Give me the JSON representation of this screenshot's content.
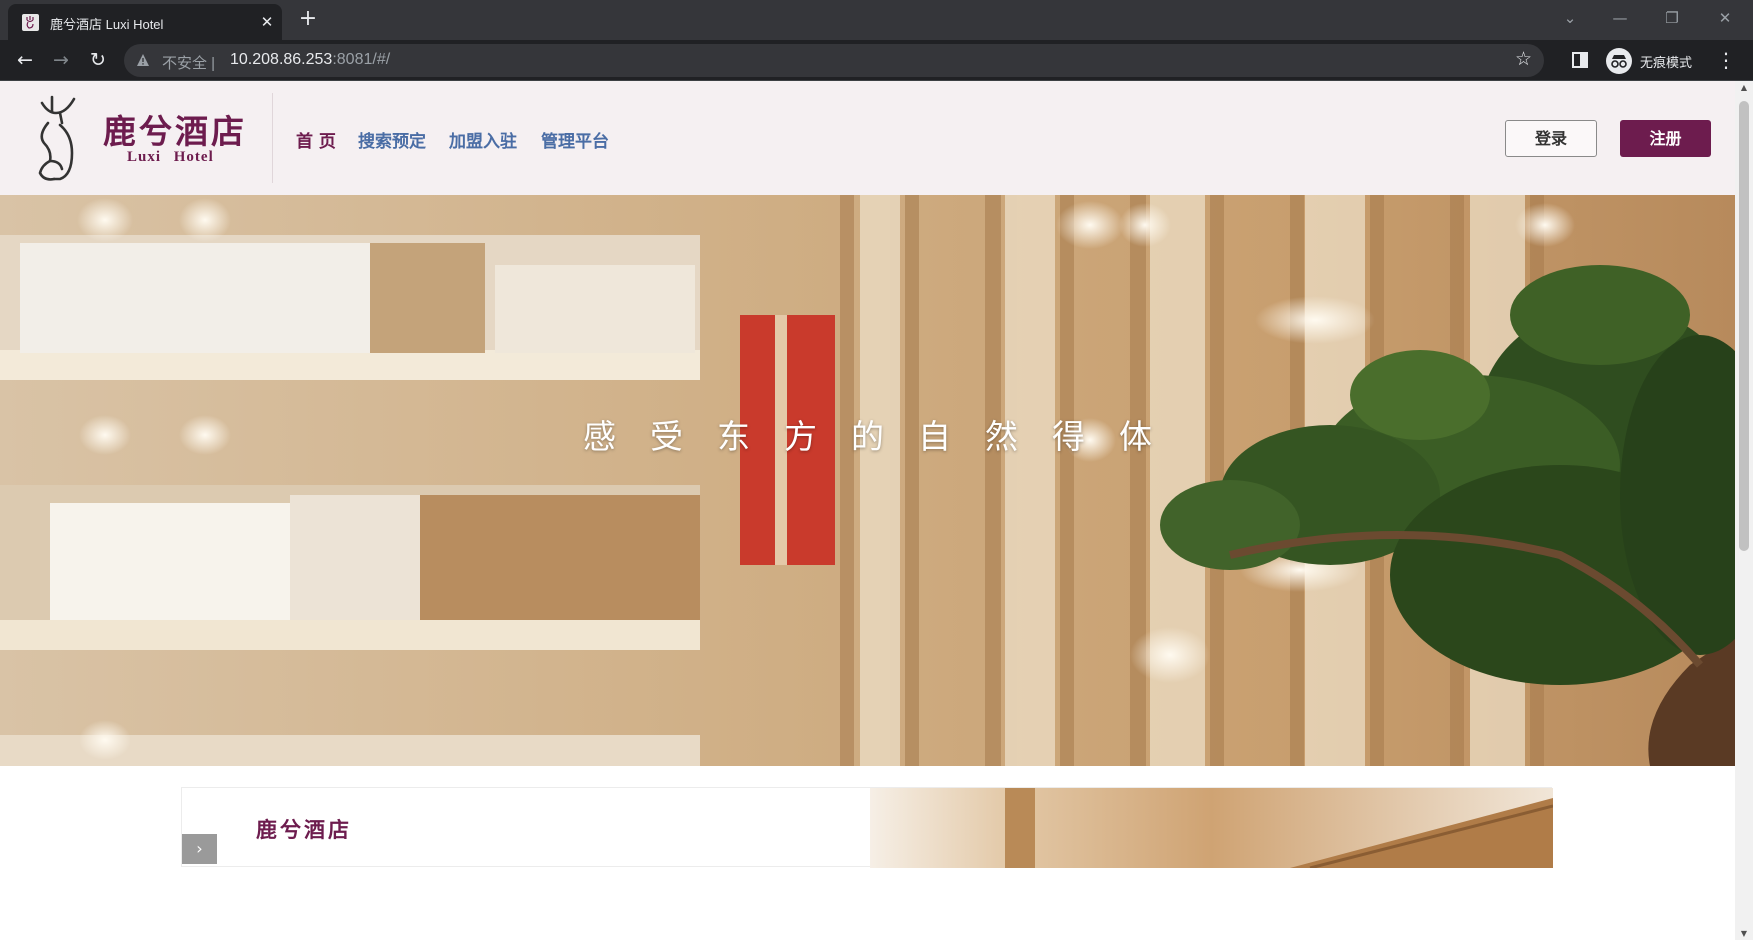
{
  "browser": {
    "tab_title": "鹿兮酒店 Luxi Hotel",
    "tab_close": "✕",
    "new_tab": "+",
    "insecure_label": "不安全 |",
    "url_host": "10.208.86.253",
    "url_rest": ":8081/#/",
    "incognito_label": "无痕模式",
    "icons": [
      "back-arrow-icon",
      "forward-arrow-icon",
      "reload-icon",
      "warning-icon",
      "star-icon",
      "side-panel-icon",
      "incognito-icon",
      "menu-icon"
    ]
  },
  "header": {
    "logo_cn": "鹿兮酒店",
    "logo_en": "Luxi Hotel",
    "nav": [
      {
        "label": "首 页",
        "active": true
      },
      {
        "label": "搜索预定",
        "active": false
      },
      {
        "label": "加盟入驻",
        "active": false
      },
      {
        "label": "管理平台",
        "active": false
      }
    ],
    "login_label": "登录",
    "register_label": "注册"
  },
  "hero": {
    "caption": "感受东方的自然得体"
  },
  "intro": {
    "title": "鹿兮酒店",
    "arrow": "›"
  },
  "colors": {
    "brand": "#6d1c4e",
    "nav_link": "#4a6da5",
    "header_bg": "#f5f0f2"
  }
}
